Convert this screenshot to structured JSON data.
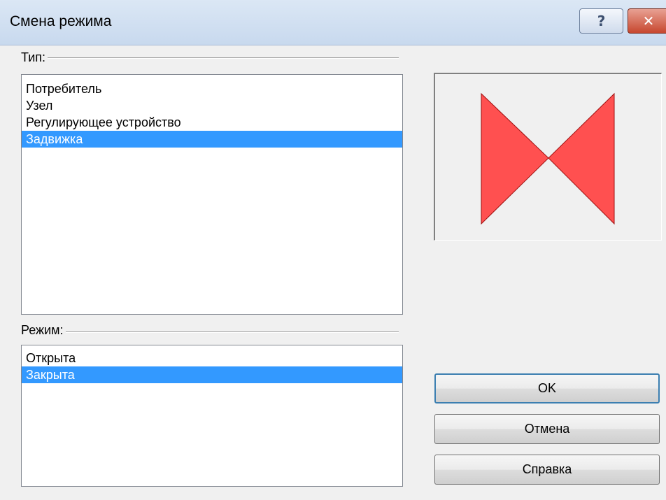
{
  "window": {
    "title": "Смена режима",
    "help_label": "?",
    "close_label": "✕"
  },
  "type_group": {
    "label": "Тип:",
    "items": [
      {
        "label": "Потребитель",
        "selected": false
      },
      {
        "label": "Узел",
        "selected": false
      },
      {
        "label": "Регулирующее устройство",
        "selected": false
      },
      {
        "label": "Задвижка",
        "selected": true
      }
    ]
  },
  "mode_group": {
    "label": "Режим:",
    "items": [
      {
        "label": "Открыта",
        "selected": false
      },
      {
        "label": "Закрыта",
        "selected": true
      }
    ]
  },
  "preview": {
    "icon": "valve-closed-icon",
    "fill_color": "#ff5050",
    "stroke_color": "#a01010"
  },
  "buttons": {
    "ok": "OK",
    "cancel": "Отмена",
    "help": "Справка"
  },
  "colors": {
    "selection": "#3399ff",
    "titlebar": "#dbe7f5"
  }
}
